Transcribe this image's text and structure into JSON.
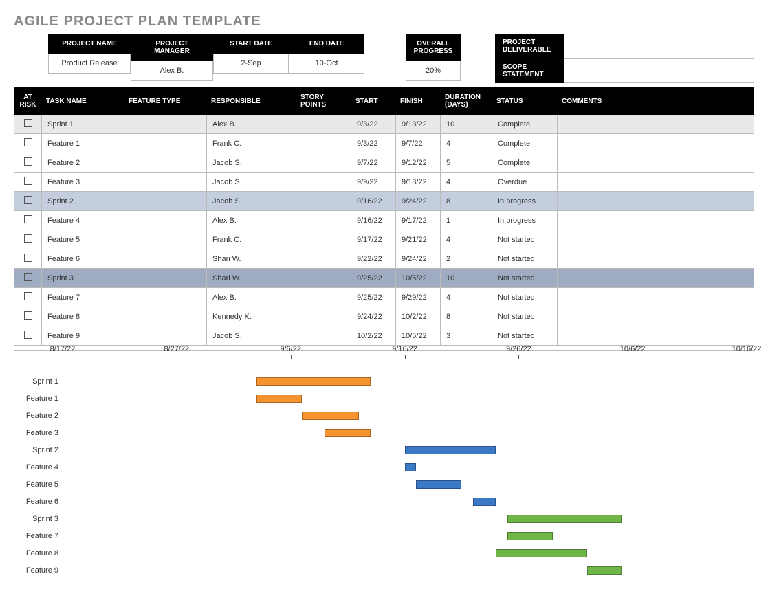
{
  "title": "AGILE PROJECT PLAN TEMPLATE",
  "info": {
    "project_name_label": "PROJECT NAME",
    "project_name": "Product Release",
    "project_manager_label": "PROJECT MANAGER",
    "project_manager": "Alex B.",
    "start_date_label": "START DATE",
    "start_date": "2-Sep",
    "end_date_label": "END DATE",
    "end_date": "10-Oct",
    "overall_progress_label": "OVERALL PROGRESS",
    "overall_progress": "20%",
    "project_deliverable_label": "PROJECT DELIVERABLE",
    "scope_statement_label": "SCOPE STATEMENT"
  },
  "columns": {
    "at_risk": "AT RISK",
    "task_name": "TASK NAME",
    "feature_type": "FEATURE TYPE",
    "responsible": "RESPONSIBLE",
    "story_points": "STORY POINTS",
    "start": "START",
    "finish": "FINISH",
    "duration": "DURATION (DAYS)",
    "status": "STATUS",
    "comments": "COMMENTS"
  },
  "rows": [
    {
      "row_class": "sprint-light",
      "task": "Sprint 1",
      "type": "",
      "resp": "Alex B.",
      "sp": "",
      "start": "9/3/22",
      "finish": "9/13/22",
      "dur": "10",
      "status": "Complete",
      "comments": ""
    },
    {
      "row_class": "",
      "task": "Feature 1",
      "type": "",
      "resp": "Frank C.",
      "sp": "",
      "start": "9/3/22",
      "finish": "9/7/22",
      "dur": "4",
      "status": "Complete",
      "comments": ""
    },
    {
      "row_class": "",
      "task": "Feature 2",
      "type": "",
      "resp": "Jacob S.",
      "sp": "",
      "start": "9/7/22",
      "finish": "9/12/22",
      "dur": "5",
      "status": "Complete",
      "comments": ""
    },
    {
      "row_class": "",
      "task": "Feature 3",
      "type": "",
      "resp": "Jacob S.",
      "sp": "",
      "start": "9/9/22",
      "finish": "9/13/22",
      "dur": "4",
      "status": "Overdue",
      "comments": ""
    },
    {
      "row_class": "sprint-blue1",
      "task": "Sprint 2",
      "type": "",
      "resp": "Jacob S.",
      "sp": "",
      "start": "9/16/22",
      "finish": "9/24/22",
      "dur": "8",
      "status": "In progress",
      "comments": ""
    },
    {
      "row_class": "",
      "task": "Feature 4",
      "type": "",
      "resp": "Alex B.",
      "sp": "",
      "start": "9/16/22",
      "finish": "9/17/22",
      "dur": "1",
      "status": "In progress",
      "comments": ""
    },
    {
      "row_class": "",
      "task": "Feature 5",
      "type": "",
      "resp": "Frank C.",
      "sp": "",
      "start": "9/17/22",
      "finish": "9/21/22",
      "dur": "4",
      "status": "Not started",
      "comments": ""
    },
    {
      "row_class": "",
      "task": "Feature 6",
      "type": "",
      "resp": "Shari W.",
      "sp": "",
      "start": "9/22/22",
      "finish": "9/24/22",
      "dur": "2",
      "status": "Not started",
      "comments": ""
    },
    {
      "row_class": "sprint-blue2",
      "task": "Sprint 3",
      "type": "",
      "resp": "Shari W.",
      "sp": "",
      "start": "9/25/22",
      "finish": "10/5/22",
      "dur": "10",
      "status": "Not started",
      "comments": ""
    },
    {
      "row_class": "",
      "task": "Feature 7",
      "type": "",
      "resp": "Alex B.",
      "sp": "",
      "start": "9/25/22",
      "finish": "9/29/22",
      "dur": "4",
      "status": "Not started",
      "comments": ""
    },
    {
      "row_class": "",
      "task": "Feature 8",
      "type": "",
      "resp": "Kennedy K.",
      "sp": "",
      "start": "9/24/22",
      "finish": "10/2/22",
      "dur": "8",
      "status": "Not started",
      "comments": ""
    },
    {
      "row_class": "",
      "task": "Feature 9",
      "type": "",
      "resp": "Jacob S.",
      "sp": "",
      "start": "10/2/22",
      "finish": "10/5/22",
      "dur": "3",
      "status": "Not started",
      "comments": ""
    }
  ],
  "chart_data": {
    "type": "gantt",
    "x_axis_dates": [
      "8/17/22",
      "8/27/22",
      "9/6/22",
      "9/16/22",
      "9/26/22",
      "10/6/22",
      "10/16/22"
    ],
    "x_range_days": {
      "start": "8/17/22",
      "end": "10/16/22",
      "total": 60
    },
    "series": [
      {
        "name": "Sprint 1",
        "start_offset": 17,
        "duration": 10,
        "color": "orange"
      },
      {
        "name": "Feature 1",
        "start_offset": 17,
        "duration": 4,
        "color": "orange"
      },
      {
        "name": "Feature 2",
        "start_offset": 21,
        "duration": 5,
        "color": "orange"
      },
      {
        "name": "Feature 3",
        "start_offset": 23,
        "duration": 4,
        "color": "orange"
      },
      {
        "name": "Sprint 2",
        "start_offset": 30,
        "duration": 8,
        "color": "blue"
      },
      {
        "name": "Feature 4",
        "start_offset": 30,
        "duration": 1,
        "color": "blue"
      },
      {
        "name": "Feature 5",
        "start_offset": 31,
        "duration": 4,
        "color": "blue"
      },
      {
        "name": "Feature 6",
        "start_offset": 36,
        "duration": 2,
        "color": "blue"
      },
      {
        "name": "Sprint 3",
        "start_offset": 39,
        "duration": 10,
        "color": "green"
      },
      {
        "name": "Feature 7",
        "start_offset": 39,
        "duration": 4,
        "color": "green"
      },
      {
        "name": "Feature 8",
        "start_offset": 38,
        "duration": 8,
        "color": "green"
      },
      {
        "name": "Feature 9",
        "start_offset": 46,
        "duration": 3,
        "color": "green"
      }
    ]
  }
}
